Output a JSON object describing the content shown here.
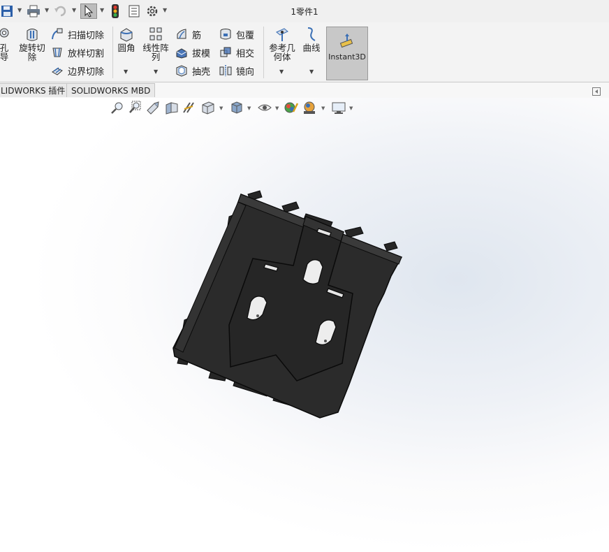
{
  "window": {
    "title": "1零件1"
  },
  "quick_access": {
    "icons": [
      "save-icon",
      "print-icon",
      "undo-icon",
      "select-icon",
      "rebuild-icon",
      "file-properties-icon",
      "options-icon"
    ]
  },
  "ribbon": {
    "hole_wizard_partial": "孔\n导",
    "revolved_cut": "旋转切\n除",
    "swept_cut": "扫描切除",
    "lofted_cut": "放样切割",
    "boundary_cut": "边界切除",
    "fillet": "圆角",
    "linear_pattern": "线性阵\n列",
    "rib": "筋",
    "draft": "拔模",
    "shell": "抽壳",
    "wrap": "包覆",
    "intersect": "相交",
    "mirror": "镜向",
    "reference_geometry": "参考几\n何体",
    "curves": "曲线",
    "instant3d": "Instant3D"
  },
  "tabs": [
    {
      "label": "LIDWORKS 插件"
    },
    {
      "label": "SOLIDWORKS MBD"
    }
  ],
  "heads_up_toolbar": {
    "icons": [
      "zoom-to-fit-icon",
      "zoom-area-icon",
      "previous-view-icon",
      "section-view-icon",
      "dynamic-annotation-icon",
      "view-orientation-icon",
      "display-style-icon",
      "hide-show-icon",
      "edit-appearance-icon",
      "apply-scene-icon",
      "view-settings-icon"
    ]
  },
  "colors": {
    "part_body": "#2b2b2b",
    "part_edge": "#0a0a0a",
    "accent_select": "#bdbdbd"
  }
}
